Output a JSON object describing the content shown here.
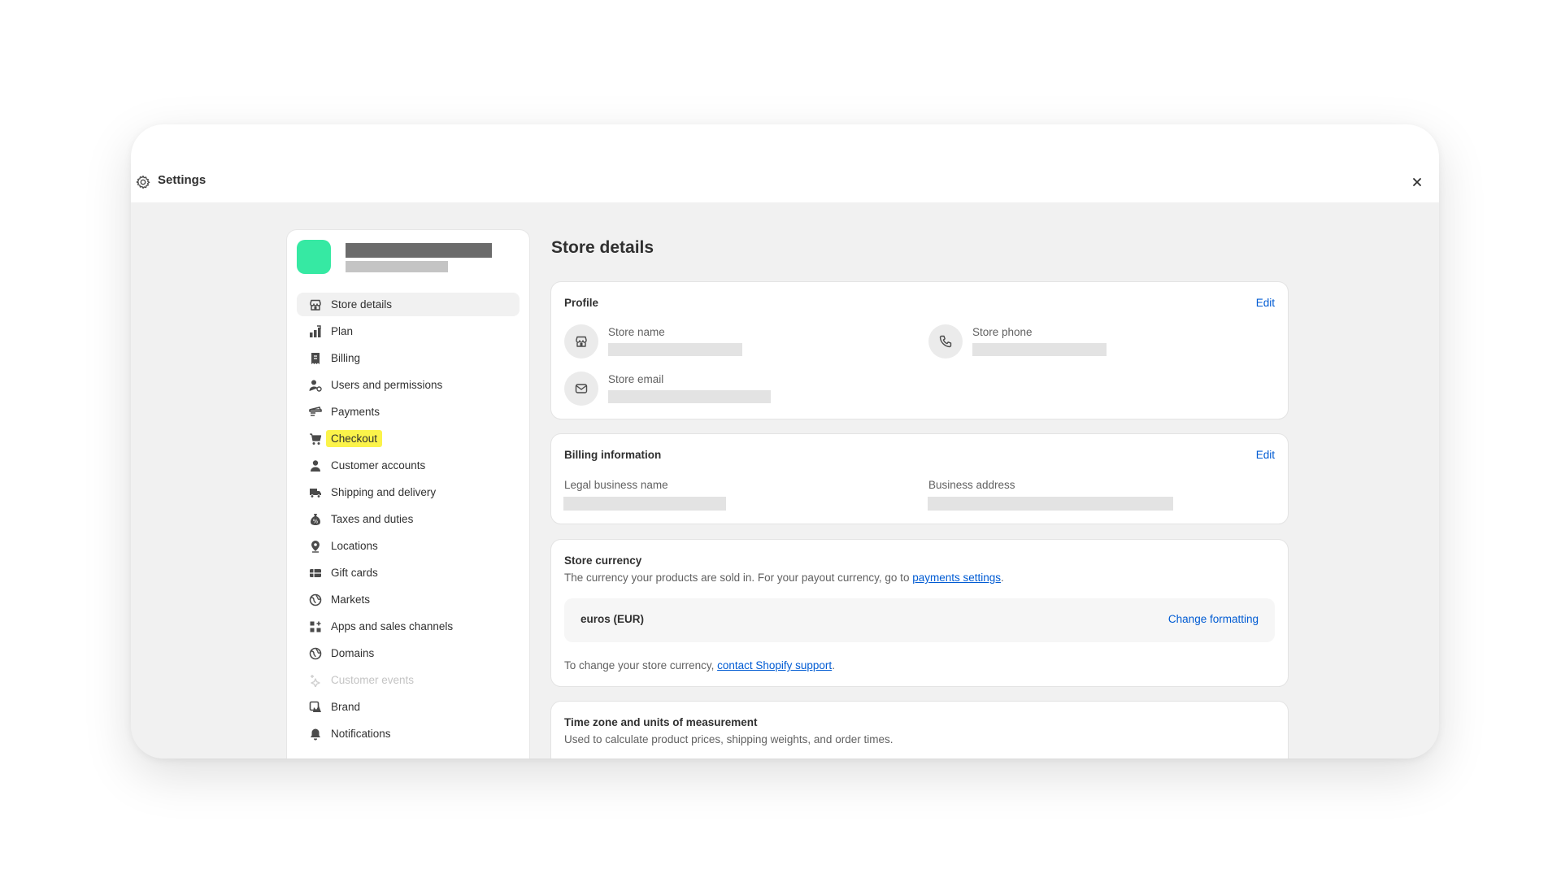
{
  "window": {
    "title": "Settings"
  },
  "sidebar": {
    "items": [
      {
        "label": "Store details",
        "icon": "store-icon"
      },
      {
        "label": "Plan",
        "icon": "plan-icon"
      },
      {
        "label": "Billing",
        "icon": "billing-icon"
      },
      {
        "label": "Users and permissions",
        "icon": "users-icon"
      },
      {
        "label": "Payments",
        "icon": "payments-icon"
      },
      {
        "label": "Checkout",
        "icon": "cart-icon"
      },
      {
        "label": "Customer accounts",
        "icon": "person-icon"
      },
      {
        "label": "Shipping and delivery",
        "icon": "truck-icon"
      },
      {
        "label": "Taxes and duties",
        "icon": "tax-icon"
      },
      {
        "label": "Locations",
        "icon": "location-icon"
      },
      {
        "label": "Gift cards",
        "icon": "gift-card-icon"
      },
      {
        "label": "Markets",
        "icon": "globe-icon"
      },
      {
        "label": "Apps and sales channels",
        "icon": "apps-icon"
      },
      {
        "label": "Domains",
        "icon": "globe-icon"
      },
      {
        "label": "Customer events",
        "icon": "sparkle-icon"
      },
      {
        "label": "Brand",
        "icon": "brand-icon"
      },
      {
        "label": "Notifications",
        "icon": "bell-icon"
      }
    ],
    "active_item": "Store details",
    "highlighted_item": "Checkout",
    "disabled_item": "Customer events"
  },
  "main": {
    "title": "Store details",
    "profile": {
      "title": "Profile",
      "edit_label": "Edit",
      "store_name_label": "Store name",
      "store_phone_label": "Store phone",
      "store_email_label": "Store email"
    },
    "billing": {
      "title": "Billing information",
      "edit_label": "Edit",
      "legal_name_label": "Legal business name",
      "address_label": "Business address"
    },
    "currency": {
      "title": "Store currency",
      "desc_prefix": "The currency your products are sold in. For your payout currency, go to ",
      "desc_link": "payments settings",
      "desc_suffix": ".",
      "value": "euros (EUR)",
      "change_label": "Change formatting",
      "footer_prefix": "To change your store currency, ",
      "footer_link": "contact Shopify support",
      "footer_suffix": "."
    },
    "timezone": {
      "title": "Time zone and units of measurement",
      "desc": "Used to calculate product prices, shipping weights, and order times."
    }
  },
  "colors": {
    "accent_link": "#005bd3",
    "store_avatar": "#36e9a3",
    "highlight": "#fbf34a"
  }
}
